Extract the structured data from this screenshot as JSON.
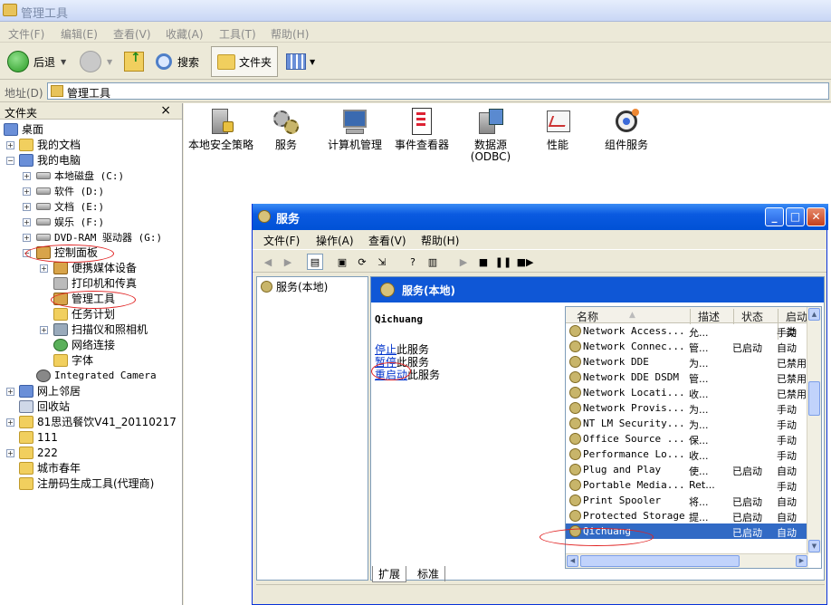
{
  "window": {
    "title": "管理工具"
  },
  "menu": [
    "文件(F)",
    "编辑(E)",
    "查看(V)",
    "收藏(A)",
    "工具(T)",
    "帮助(H)"
  ],
  "toolbar": {
    "back": "后退",
    "search": "搜索",
    "folders": "文件夹"
  },
  "address": {
    "label": "地址(D)",
    "value": "管理工具"
  },
  "leftpane": {
    "title": "文件夹",
    "close": "×",
    "tree": [
      {
        "label": "桌面"
      },
      {
        "label": "我的文档"
      },
      {
        "label": "我的电脑"
      },
      {
        "label": "本地磁盘 (C:)"
      },
      {
        "label": "软件 (D:)"
      },
      {
        "label": "文档 (E:)"
      },
      {
        "label": "娱乐 (F:)"
      },
      {
        "label": "DVD-RAM 驱动器 (G:)"
      },
      {
        "label": "控制面板"
      },
      {
        "label": "便携媒体设备"
      },
      {
        "label": "打印机和传真"
      },
      {
        "label": "管理工具"
      },
      {
        "label": "任务计划"
      },
      {
        "label": "扫描仪和照相机"
      },
      {
        "label": "网络连接"
      },
      {
        "label": "字体"
      },
      {
        "label": "Integrated Camera"
      },
      {
        "label": "网上邻居"
      },
      {
        "label": "回收站"
      },
      {
        "label": "81思迅餐饮V41_20110217"
      },
      {
        "label": "111"
      },
      {
        "label": "222"
      },
      {
        "label": "城市春年"
      },
      {
        "label": "注册码生成工具(代理商)"
      }
    ]
  },
  "apps": [
    {
      "label": "本地安全策略"
    },
    {
      "label": "服务"
    },
    {
      "label": "计算机管理"
    },
    {
      "label": "事件查看器"
    },
    {
      "label": "数据源 (ODBC)"
    },
    {
      "label": "性能"
    },
    {
      "label": "组件服务"
    }
  ],
  "services": {
    "title": "服务",
    "menu": [
      "文件(F)",
      "操作(A)",
      "查看(V)",
      "帮助(H)"
    ],
    "tree_item": "服务(本地)",
    "header": "服务(本地)",
    "selected_name": "Qichuang",
    "actions": {
      "stop": "停止",
      "stop_suffix": "此服务",
      "pause": "暂停",
      "pause_suffix": "此服务",
      "restart": "重启动",
      "restart_suffix": "此服务"
    },
    "columns": [
      "名称",
      "描述",
      "状态",
      "启动类"
    ],
    "rows": [
      {
        "name": "Network Access...",
        "desc": "允...",
        "status": "",
        "start": "手动"
      },
      {
        "name": "Network Connec...",
        "desc": "管...",
        "status": "已启动",
        "start": "自动"
      },
      {
        "name": "Network DDE",
        "desc": "为...",
        "status": "",
        "start": "已禁用"
      },
      {
        "name": "Network DDE DSDM",
        "desc": "管...",
        "status": "",
        "start": "已禁用"
      },
      {
        "name": "Network Locati...",
        "desc": "收...",
        "status": "",
        "start": "已禁用"
      },
      {
        "name": "Network Provis...",
        "desc": "为...",
        "status": "",
        "start": "手动"
      },
      {
        "name": "NT LM Security...",
        "desc": "为...",
        "status": "",
        "start": "手动"
      },
      {
        "name": "Office Source ...",
        "desc": "保...",
        "status": "",
        "start": "手动"
      },
      {
        "name": "Performance Lo...",
        "desc": "收...",
        "status": "",
        "start": "手动"
      },
      {
        "name": "Plug and Play",
        "desc": "使...",
        "status": "已启动",
        "start": "自动"
      },
      {
        "name": "Portable Media...",
        "desc": "Ret...",
        "status": "",
        "start": "手动"
      },
      {
        "name": "Print Spooler",
        "desc": "将...",
        "status": "已启动",
        "start": "自动"
      },
      {
        "name": "Protected Storage",
        "desc": "提...",
        "status": "已启动",
        "start": "自动"
      },
      {
        "name": "Qichuang",
        "desc": "",
        "status": "已启动",
        "start": "自动"
      }
    ],
    "tabs": [
      "扩展",
      "标准"
    ]
  }
}
